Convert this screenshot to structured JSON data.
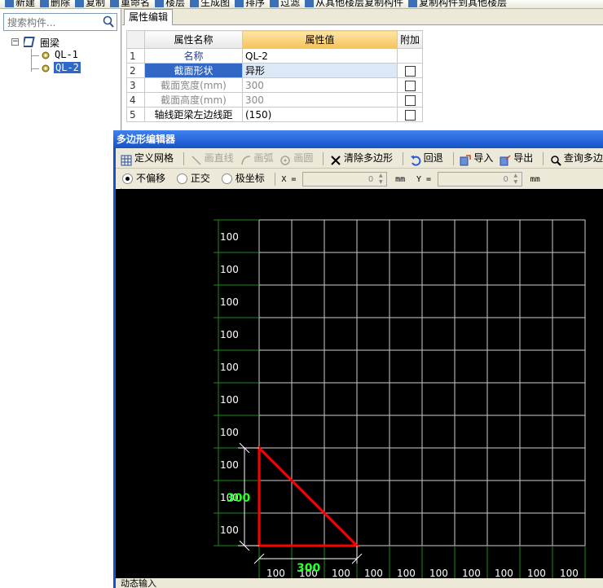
{
  "top_toolbar": {
    "items": [
      "新建",
      "删除",
      "复制",
      "重命名",
      "楼层",
      "生成图",
      "排序",
      "过滤",
      "从其他楼层复制构件",
      "复制构件到其他楼层"
    ]
  },
  "left_pane": {
    "search_placeholder": "搜索构件...",
    "tree": {
      "root_label": "圈梁",
      "children": [
        "QL-1",
        "QL-2"
      ],
      "selected": "QL-2"
    }
  },
  "properties": {
    "tab_label": "属性编辑",
    "headers": {
      "name": "属性名称",
      "value": "属性值",
      "add": "附加"
    },
    "rows": [
      {
        "num": "1",
        "name": "名称",
        "value": "QL-2",
        "has_check": false,
        "style": "blue"
      },
      {
        "num": "2",
        "name": "截面形状",
        "value": "异形",
        "has_check": true,
        "style": "selected"
      },
      {
        "num": "3",
        "name": "截面宽度(mm)",
        "value": "300",
        "has_check": true,
        "style": "grey"
      },
      {
        "num": "4",
        "name": "截面高度(mm)",
        "value": "300",
        "has_check": true,
        "style": "grey"
      },
      {
        "num": "5",
        "name": "轴线距梁左边线距",
        "value": "(150)",
        "has_check": true,
        "style": "normal"
      }
    ]
  },
  "editor": {
    "title": "多边形编辑器",
    "toolbar": {
      "define_grid": "定义网格",
      "draw_line": "画直线",
      "draw_arc": "画弧",
      "draw_circle": "画圆",
      "clear_polygon": "清除多边形",
      "undo": "回退",
      "import": "导入",
      "export": "导出",
      "query_polygon": "查询多边形"
    },
    "options": {
      "no_offset": "不偏移",
      "orthogonal": "正交",
      "polar": "极坐标",
      "x_label": "X =",
      "x_value": "0",
      "x_unit": "mm",
      "y_label": "Y =",
      "y_value": "0",
      "y_unit": "mm"
    },
    "grid": {
      "cell_label": "100",
      "dim_horizontal": "300",
      "dim_vertical": "300",
      "polygon_color": "#ff0000",
      "dim_text_color": "#33ff33",
      "grid_color": "#cfcfcf",
      "axis_color": "#1f8a1f"
    },
    "status_tab": "动态输入"
  }
}
